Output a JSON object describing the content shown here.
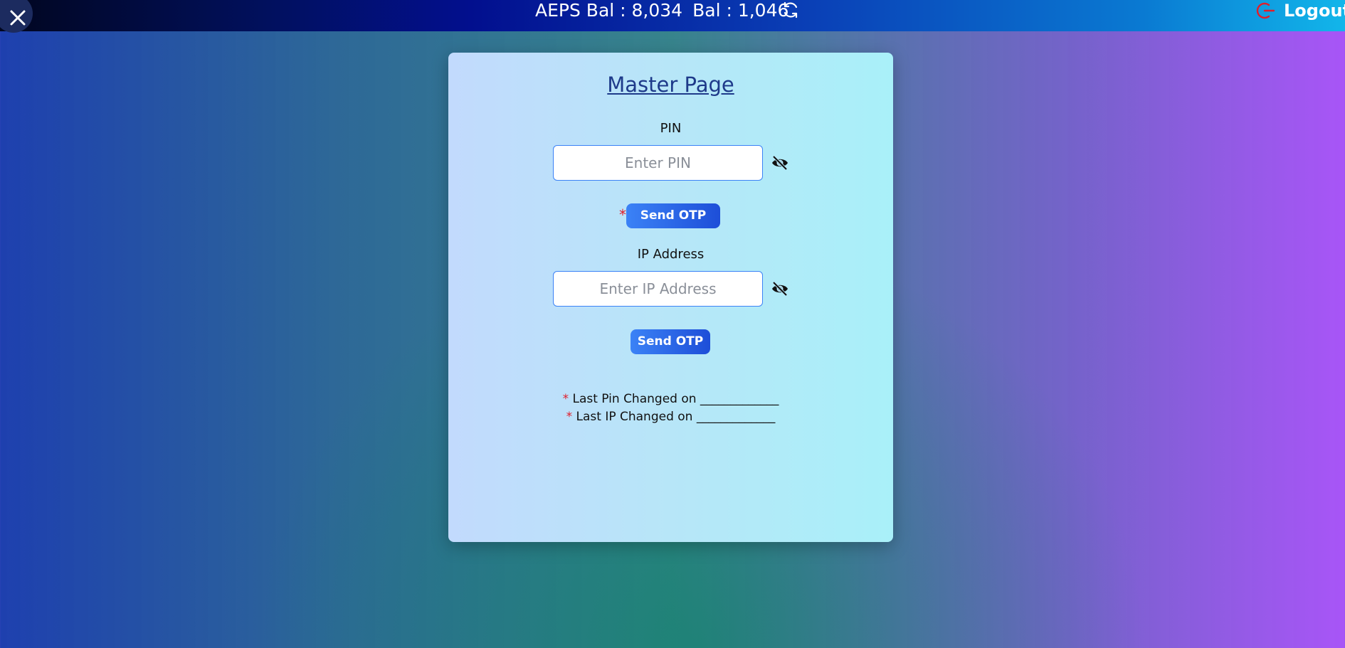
{
  "topbar": {
    "aeps_balance": "AEPS Bal : 8,034",
    "balance": "Bal : 1,046",
    "logout_label": "Logout"
  },
  "card": {
    "title": "Master Page",
    "pin": {
      "label": "PIN",
      "placeholder": "Enter PIN",
      "value": ""
    },
    "pin_send_otp": {
      "required_mark": "*",
      "label": "Send OTP"
    },
    "ip": {
      "label": "IP Address",
      "placeholder": "Enter IP Address",
      "value": ""
    },
    "ip_send_otp": {
      "label": "Send OTP"
    },
    "notes": [
      {
        "mark": "*",
        "text": "Last Pin Changed on _____________"
      },
      {
        "mark": "*",
        "text": "Last IP Changed on _____________"
      }
    ]
  },
  "colors": {
    "accent": "#2563eb",
    "required": "#e11d2a",
    "title": "#1e3a8a"
  },
  "icons": [
    "close-icon",
    "refresh-icon",
    "logout-icon",
    "eye-slash-icon"
  ]
}
